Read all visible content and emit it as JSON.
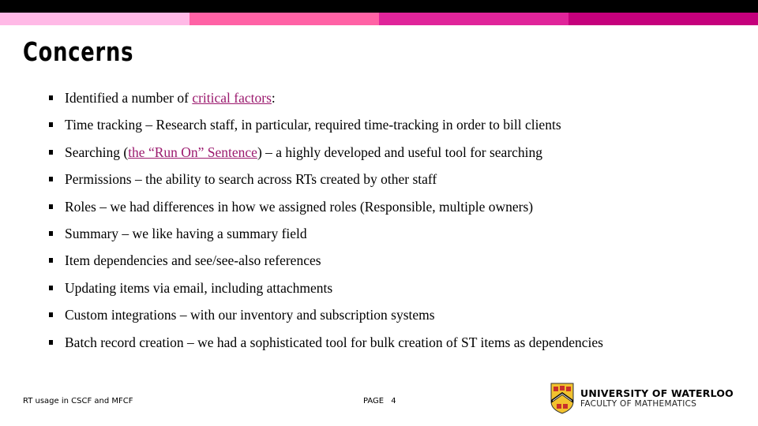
{
  "header": {
    "accent_colors": [
      "#ffb9e6",
      "#ff62a5",
      "#e0249a",
      "#c5007c"
    ]
  },
  "slide": {
    "title": "Concerns",
    "bullets": [
      {
        "parts": [
          {
            "text": "Identified a number of "
          },
          {
            "text": "critical factors",
            "link": true
          },
          {
            "text": ":"
          }
        ]
      },
      {
        "parts": [
          {
            "text": "Time tracking – Research staff, in particular, required time-tracking in order to bill clients"
          }
        ]
      },
      {
        "parts": [
          {
            "text": "Searching ("
          },
          {
            "text": "the “Run On” Sentence",
            "link": true
          },
          {
            "text": ") – a highly developed and useful tool for searching"
          }
        ]
      },
      {
        "parts": [
          {
            "text": "Permissions – the ability to search across RTs created by other staff"
          }
        ]
      },
      {
        "parts": [
          {
            "text": "Roles – we had differences in how we assigned roles (Responsible, multiple owners)"
          }
        ]
      },
      {
        "parts": [
          {
            "text": "Summary – we like having a summary field"
          }
        ]
      },
      {
        "parts": [
          {
            "text": "Item dependencies and see/see-also references"
          }
        ]
      },
      {
        "parts": [
          {
            "text": "Updating items via email, including attachments"
          }
        ]
      },
      {
        "parts": [
          {
            "text": "Custom integrations – with our inventory and subscription systems"
          }
        ]
      },
      {
        "parts": [
          {
            "text": "Batch record creation – we had a sophisticated tool for bulk creation of ST items as dependencies"
          }
        ]
      }
    ],
    "link_color": "#9b1a6e"
  },
  "footer": {
    "presentation_title": "RT usage in CSCF and MFCF",
    "page_label": "PAGE 4",
    "logo": {
      "university": "UNIVERSITY OF WATERLOO",
      "faculty": "FACULTY OF MATHEMATICS",
      "crest_icon": "university-crest-icon"
    }
  }
}
